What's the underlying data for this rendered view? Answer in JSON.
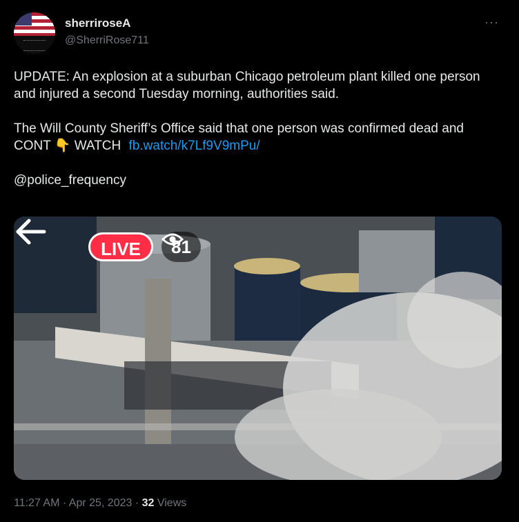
{
  "author": {
    "name": "sherriroseA",
    "handle": "@SherriRose711"
  },
  "more_label": "···",
  "tweet": {
    "line1": "UPDATE: An explosion at a suburban Chicago petroleum plant killed one person and injured a second Tuesday morning, authorities said.",
    "line2": "The Will County Sheriff’s Office said that one person was confirmed dead and",
    "line3_prefix": "CONT 👇 WATCH",
    "link": "fb.watch/k7Lf9V9mPu/",
    "mention": "@police_frequency"
  },
  "media": {
    "live_label": "LIVE",
    "viewer_count": "81"
  },
  "footer": {
    "time": "11:27 AM",
    "sep1": " · ",
    "date": "Apr 25, 2023",
    "sep2": " · ",
    "views_count": "32",
    "views_label": " Views"
  },
  "colors": {
    "accent": "#1d9bf0",
    "live": "#ff2d46",
    "muted": "#71767b"
  }
}
